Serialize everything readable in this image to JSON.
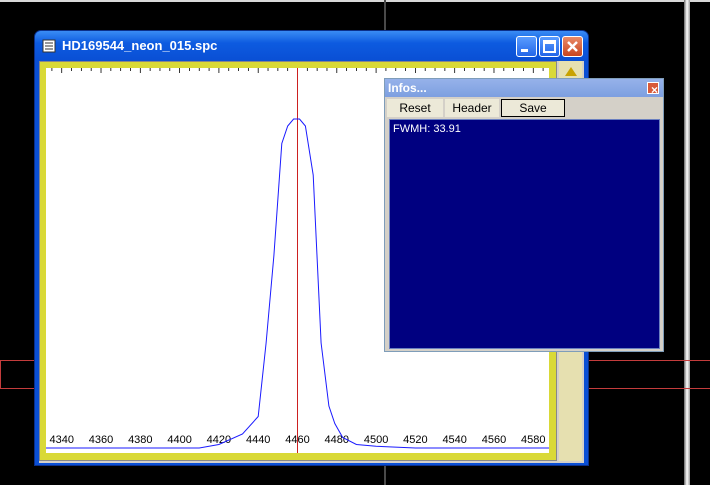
{
  "window": {
    "title": "HD169544_neon_015.spc"
  },
  "infos": {
    "title": "Infos...",
    "buttons": [
      "Reset",
      "Header",
      "Save"
    ],
    "fwhm_text": "FWMH:  33.91"
  },
  "chart_data": {
    "type": "line",
    "xlabel": "",
    "ylabel": "",
    "xlim": [
      4332,
      4588
    ],
    "ylim": [
      0,
      1
    ],
    "grid": false,
    "x_ticks": [
      4340,
      4360,
      4380,
      4400,
      4420,
      4440,
      4460,
      4480,
      4500,
      4520,
      4540,
      4560,
      4580
    ],
    "marker_x": 4460,
    "series": [
      {
        "x": [
          4332,
          4380,
          4410,
          4420,
          4432,
          4440,
          4444,
          4448,
          4452,
          4455,
          4458,
          4461,
          4464,
          4468,
          4472,
          4476,
          4479,
          4483,
          4490,
          4500,
          4520,
          4588
        ],
        "y": [
          0.0,
          0.0,
          0.0,
          0.01,
          0.04,
          0.09,
          0.3,
          0.55,
          0.87,
          0.92,
          0.94,
          0.94,
          0.92,
          0.78,
          0.3,
          0.12,
          0.07,
          0.03,
          0.01,
          0.005,
          0.0,
          0.0
        ]
      }
    ]
  },
  "colors": {
    "curve": "#1a1aff",
    "marker": "#cc2020",
    "info_bg": "#000080"
  }
}
